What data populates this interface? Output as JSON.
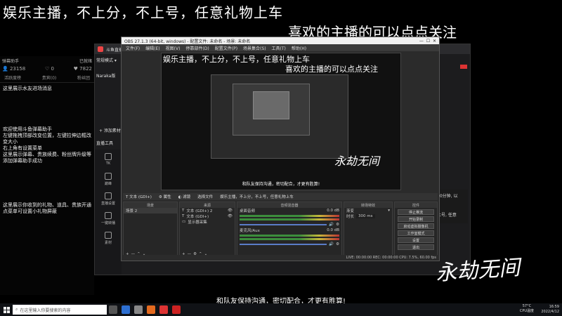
{
  "overlay": {
    "line1": "娱乐主播，不上分，不上号，任意礼物上车",
    "line2": "喜欢的主播的可以点点关注"
  },
  "left_panel": {
    "title": "弹幕助手",
    "status": "已就绪",
    "stats": {
      "viewers": "23158",
      "likes": "0",
      "fans": "7822"
    },
    "tabs": [
      "活跃度榜",
      "贵宾(0)",
      "粉丝团"
    ],
    "msg_area": "这里展示水友进场消息",
    "help": "欢迎使用斗鱼弹幕助手\n左键拖拽顶部改变位置，左键拉伸边框改变大小\n右上角有设置菜单\n这里展示弹幕、贵族续费、粉丝牌升级等\n添加弹幕助手成功",
    "gifts": "这里展示你收到的礼物、道具、贵族开通\n点菜单可设置小礼物屏蔽"
  },
  "obs_bg": {
    "app_name": "斗鱼直播",
    "mode": "常规模式",
    "scene": "Naraka版",
    "add_source": "+ 添加素材",
    "tools_title": "直播工具",
    "strip": [
      "TK",
      "巅峰",
      "直播设置",
      "一键转播",
      "素材"
    ]
  },
  "obs_window": {
    "title": "OBS 27.1.3 (64-bit, windows) - 配置文件: 未命名 - 场景: 未命名",
    "menu": [
      "文件(F)",
      "编辑(E)",
      "视图(V)",
      "停靠部件(D)",
      "配置文件(P)",
      "场景集合(S)",
      "工具(T)",
      "帮助(H)"
    ],
    "preview_caption": "和队友保持沟通，密切配合，才更有胜算!",
    "preview_logo": "永劫无间",
    "toolbar": [
      "文本 (GDI+)",
      "属性",
      "滤镜",
      "选择文件",
      "娱乐主播，不上分，不上号，任意礼物上车"
    ],
    "docks": {
      "scenes_title": "场景",
      "scene_item": "场景 2",
      "sources_title": "来源",
      "sources": [
        "文本 (GDI+) 2",
        "文本 (GDI+)",
        "显示器采集"
      ],
      "mixer_title": "音频混音器",
      "mixer": [
        {
          "name": "桌面音频",
          "db": "0.0 dB"
        },
        {
          "name": "麦克风/Aux",
          "db": "0.0 dB"
        }
      ],
      "transitions_title": "转场特效",
      "transition": "渐变",
      "duration_label": "时长",
      "duration": "300 ms",
      "controls_title": "控件",
      "controls": [
        "停止推流",
        "开始录制",
        "启动虚拟摄像机",
        "工作室模式",
        "设置",
        "退出"
      ]
    },
    "status": "LIVE: 00:00:00   REC: 00:00:00   CPU: 7.5%, 60.00 fps"
  },
  "right_float": {
    "line1": "10分钟, 以",
    "line2": "上号, 任意"
  },
  "big_logo": "永劫无间",
  "subtitle": "和队友保持沟通，密切配合，才更有胜算!",
  "taskbar": {
    "search_placeholder": "在这里输入你要搜索的内容",
    "weather_temp": "57°C",
    "weather_label": "CPU温度",
    "time": "16:59",
    "date": "2022/4/12"
  }
}
